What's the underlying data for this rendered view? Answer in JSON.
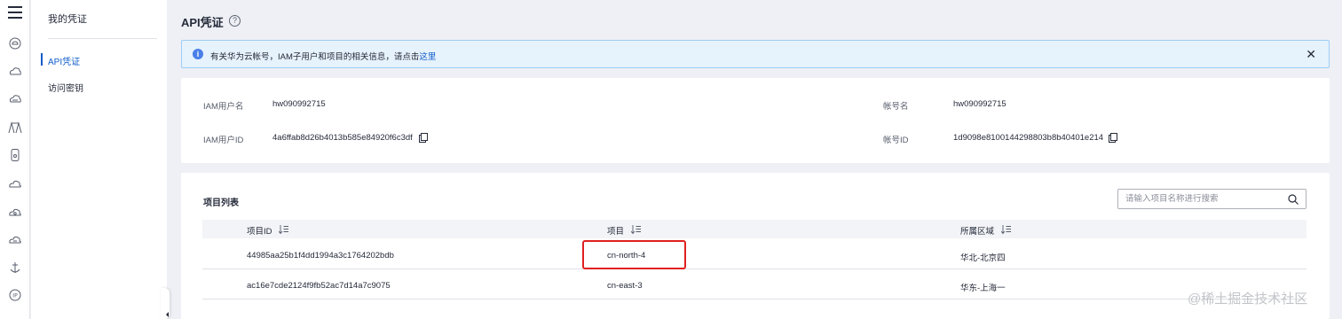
{
  "nav": {
    "title": "我的凭证",
    "items": [
      {
        "label": "API凭证",
        "active": true
      },
      {
        "label": "访问密钥",
        "active": false
      }
    ]
  },
  "rail_icons": [
    "menu-icon",
    "cloud-icon",
    "cloud-icon",
    "cloud-icon",
    "bridge-icon",
    "phone-icon",
    "cloud-icon",
    "cloud-icon",
    "cloud-icon",
    "anchor-icon",
    "badge-icon"
  ],
  "page": {
    "title": "API凭证",
    "help_glyph": "?"
  },
  "alert": {
    "text": "有关华为云帐号，IAM子用户和项目的相关信息，请点击",
    "link": "这里",
    "info_glyph": "i",
    "close_glyph": "✕",
    "color": "#e6f2fc"
  },
  "credentials": {
    "iam_user_label": "IAM用户名",
    "iam_user_value": "hw090992715",
    "iam_user_id_label": "IAM用户ID",
    "iam_user_id_value": "4a6ffab8d26b4013b585e84920f6c3df",
    "account_label": "帐号名",
    "account_value": "hw090992715",
    "account_id_label": "帐号ID",
    "account_id_value": "1d9098e8100144298803b8b40401e214"
  },
  "projects": {
    "title": "项目列表",
    "search_placeholder": "请输入项目名称进行搜索",
    "columns": [
      "项目ID",
      "项目",
      "所属区域"
    ],
    "rows": [
      {
        "id": "44985aa25b1f4dd1994a3c1764202bdb",
        "project": "cn-north-4",
        "region": "华北-北京四"
      },
      {
        "id": "ac16e7cde2124f9fb52ac7d14a7c9075",
        "project": "cn-east-3",
        "region": "华东-上海一"
      }
    ]
  },
  "watermark": "@稀土掘金技术社区",
  "colors": {
    "accent": "#0f5cc9",
    "highlight": "#e02020"
  }
}
